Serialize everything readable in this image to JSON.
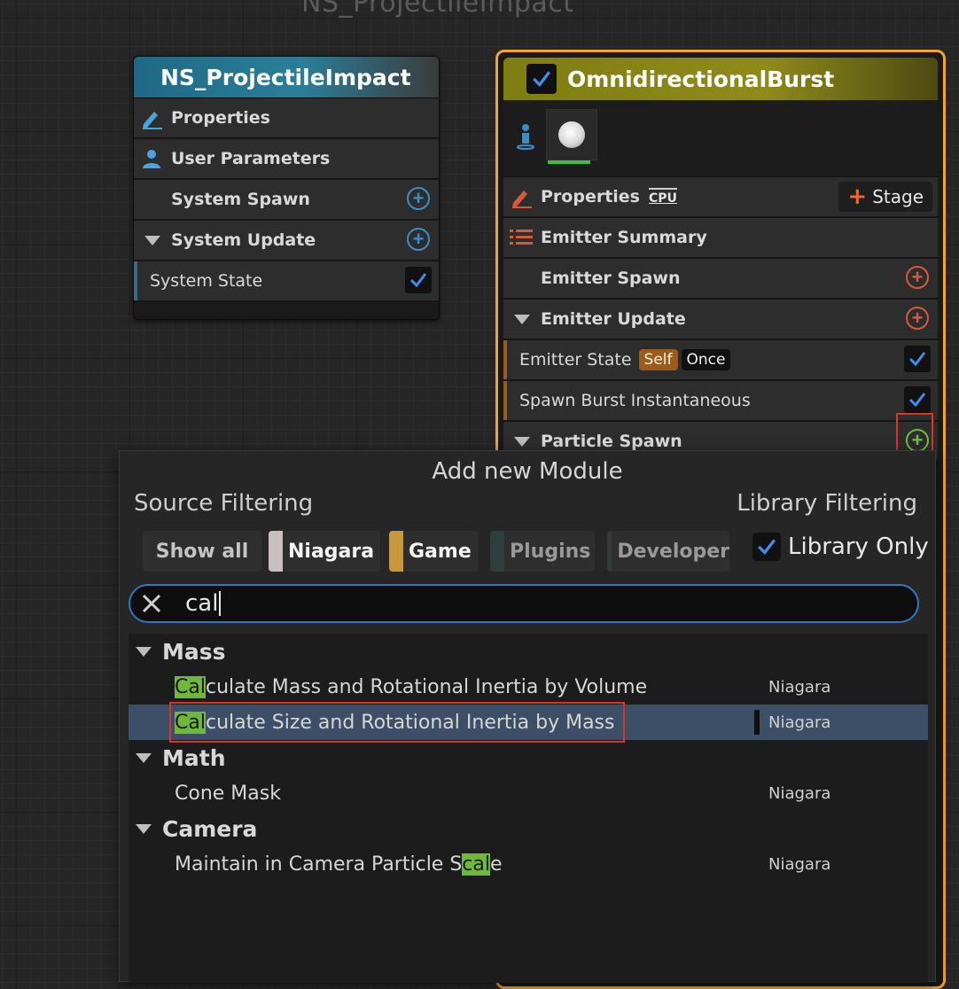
{
  "graph": {
    "title": "NS_ProjectileImpact"
  },
  "system_node": {
    "title": "NS_ProjectileImpact",
    "rows": {
      "properties": "Properties",
      "user_parameters": "User Parameters",
      "system_spawn": "System Spawn",
      "system_update": "System Update",
      "system_state": "System State"
    }
  },
  "emitter_node": {
    "title": "OmnidirectionalBurst",
    "properties": "Properties",
    "sim_target": "CPU",
    "stage_button": "Stage",
    "emitter_summary": "Emitter Summary",
    "emitter_spawn": "Emitter Spawn",
    "emitter_update": "Emitter Update",
    "emitter_state": "Emitter State",
    "tag_self": "Self",
    "tag_once": "Once",
    "spawn_burst": "Spawn Burst Instantaneous",
    "particle_spawn": "Particle Spawn"
  },
  "popup": {
    "title": "Add new Module",
    "source_filtering": "Source Filtering",
    "library_filtering": "Library Filtering",
    "chips": {
      "show_all": "Show all",
      "niagara": "Niagara",
      "game": "Game",
      "plugins": "Plugins",
      "developer": "Developer"
    },
    "library_only": "Library Only",
    "search_value": "cal",
    "results": {
      "mass": {
        "label": "Mass",
        "item1": {
          "pre": "",
          "hit": "Cal",
          "post": "culate Mass and Rotational Inertia by Volume",
          "source": "Niagara"
        },
        "item2": {
          "pre": "",
          "hit": "Cal",
          "post": "culate Size and Rotational Inertia by Mass",
          "source": "Niagara"
        }
      },
      "math": {
        "label": "Math",
        "item1": {
          "name": "Cone Mask",
          "source": "Niagara"
        }
      },
      "camera": {
        "label": "Camera",
        "item1": {
          "pre": "Maintain in Camera Particle S",
          "hit": "cal",
          "post": "e",
          "source": "Niagara"
        }
      }
    }
  },
  "colors": {
    "system_header": "#1e6a86",
    "emitter_header": "#7e7d12",
    "emitter_outline": "#f2a531",
    "selection": "#3d4f66",
    "match_highlight": "#6fb83a",
    "annotation_box": "#d9352a",
    "chip_niagara": "#c9bfc0",
    "chip_game": "#c9983e",
    "chip_plugins": "#2f3f3d",
    "chip_developer": "#2f3d33"
  }
}
